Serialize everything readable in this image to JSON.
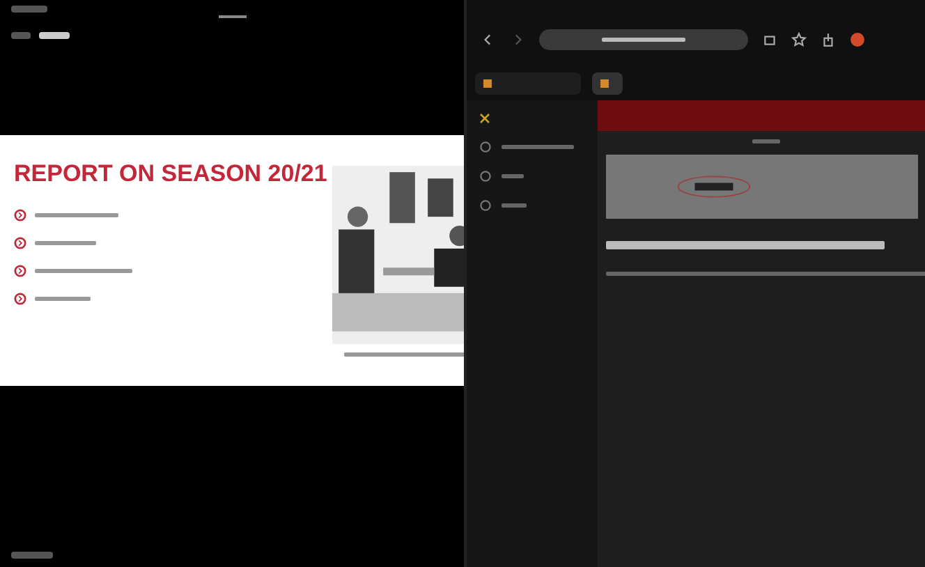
{
  "controls": [
    {
      "selected": false
    },
    {
      "selected": true
    }
  ],
  "slide": {
    "title": "REPORT ON SEASON 20/21"
  },
  "browser": {
    "tabs": [
      {
        "selected": true
      },
      {
        "selected": false
      }
    ]
  }
}
